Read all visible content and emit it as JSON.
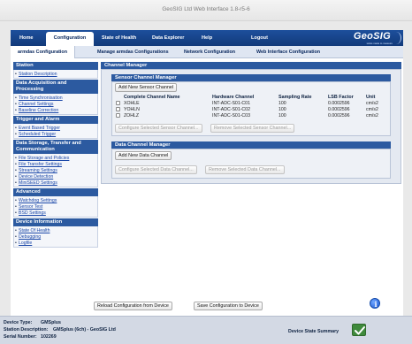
{
  "window": {
    "title": "GeoSIG Ltd Web Interface 1.8-r5-6"
  },
  "topnav": {
    "items": [
      {
        "label": "Home"
      },
      {
        "label": "Configuration"
      },
      {
        "label": "State of Health"
      },
      {
        "label": "Data Explorer"
      },
      {
        "label": "Help"
      },
      {
        "label": "Logout"
      }
    ],
    "active": "Configuration",
    "logo_text": "GeoSIG",
    "logo_tagline": "swiss made to measure"
  },
  "subnav": {
    "items": [
      {
        "label": "armdas Configuration"
      },
      {
        "label": "Manage armdas Configurations"
      },
      {
        "label": "Network Configuration"
      },
      {
        "label": "Web Interface Configuration"
      }
    ]
  },
  "sidebar": {
    "sections": [
      {
        "title": "Station",
        "links": [
          "Station Description"
        ]
      },
      {
        "title": "Data Acquisition and Processing",
        "links": [
          "Time Synchronisation",
          "Channel Settings",
          "Baseline Correction"
        ]
      },
      {
        "title": "Trigger and Alarm",
        "links": [
          "Event Based Trigger",
          "Scheduled Trigger"
        ]
      },
      {
        "title": "Data Storage, Transfer and Communication",
        "links": [
          "File Storage and Policies",
          "File Transfer Settings",
          "Streaming Settings",
          "Device Detection",
          "MiniSEED Settings"
        ]
      },
      {
        "title": "Advanced",
        "links": [
          "Watchdog Settings",
          "Sensor Test",
          "BSD Settings"
        ]
      },
      {
        "title": "Device Information",
        "links": [
          "State Of Health",
          "Debugging",
          "Logfile"
        ]
      }
    ]
  },
  "channel_manager": {
    "title": "Channel Manager",
    "sensor": {
      "title": "Sensor Channel Manager",
      "add_button": "Add New Sensor Channel",
      "columns": [
        "Complete Channel Name",
        "Hardware Channel",
        "Sampling Rate",
        "LSB Factor",
        "Unit"
      ],
      "rows": [
        [
          "XOHLE",
          "INT-ADC-S01-C01",
          "100",
          "0.0002596",
          "cm/s2"
        ],
        [
          "YOHLN",
          "INT-ADC-S01-C02",
          "100",
          "0.0002596",
          "cm/s2"
        ],
        [
          "ZOHLZ",
          "INT-ADC-S01-C03",
          "100",
          "0.0002596",
          "cm/s2"
        ]
      ],
      "configure_button": "Configure Selected Sensor Channel...",
      "remove_button": "Remove Selected Sensor Channel..."
    },
    "data": {
      "title": "Data Channel Manager",
      "add_button": "Add New Data Channel",
      "configure_button": "Configure Selected Data Channel...",
      "remove_button": "Remove Selected Data Channel..."
    }
  },
  "actions": {
    "reload": "Reload Configuration from Device",
    "save": "Save Configuration to Device"
  },
  "footer": {
    "device_type_label": "Device Type:",
    "device_type_value": "GMSplus",
    "station_desc_label": "Station Description:",
    "station_desc_value": "GMSplus (6ch) - GeoSIG Ltd",
    "serial_label": "Serial Number:",
    "serial_value": "102269",
    "state_summary_label": "Device State Summary"
  },
  "colors": {
    "nav_blue": "#1d4f9c",
    "section_blue": "#2c5aa0",
    "link_blue": "#1a47a8",
    "status_ok_green": "#3f8a3c"
  }
}
